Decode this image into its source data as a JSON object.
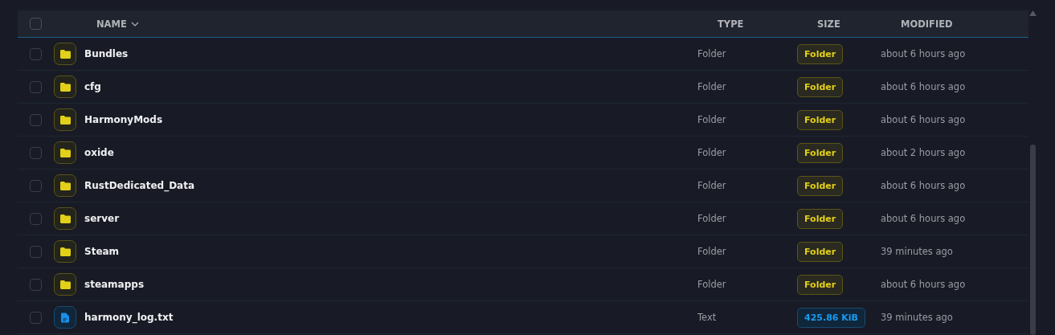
{
  "table": {
    "select_all": {
      "checked": false
    },
    "columns": [
      {
        "label": "NAME",
        "sorted": true
      },
      {
        "label": "TYPE",
        "sorted": false
      },
      {
        "label": "SIZE",
        "sorted": false
      },
      {
        "label": "MODIFIED",
        "sorted": false
      }
    ],
    "rows": [
      {
        "kind": "folder",
        "name": "Bundles",
        "type": "Folder",
        "size": "Folder",
        "modified": "about 6 hours ago",
        "checked": false
      },
      {
        "kind": "folder",
        "name": "cfg",
        "type": "Folder",
        "size": "Folder",
        "modified": "about 6 hours ago",
        "checked": false
      },
      {
        "kind": "folder",
        "name": "HarmonyMods",
        "type": "Folder",
        "size": "Folder",
        "modified": "about 6 hours ago",
        "checked": false
      },
      {
        "kind": "folder",
        "name": "oxide",
        "type": "Folder",
        "size": "Folder",
        "modified": "about 2 hours ago",
        "checked": false
      },
      {
        "kind": "folder",
        "name": "RustDedicated_Data",
        "type": "Folder",
        "size": "Folder",
        "modified": "about 6 hours ago",
        "checked": false
      },
      {
        "kind": "folder",
        "name": "server",
        "type": "Folder",
        "size": "Folder",
        "modified": "about 6 hours ago",
        "checked": false
      },
      {
        "kind": "folder",
        "name": "Steam",
        "type": "Folder",
        "size": "Folder",
        "modified": "39 minutes ago",
        "checked": false
      },
      {
        "kind": "folder",
        "name": "steamapps",
        "type": "Folder",
        "size": "Folder",
        "modified": "about 6 hours ago",
        "checked": false
      },
      {
        "kind": "file",
        "name": "harmony_log.txt",
        "type": "Text",
        "size": "425.86 KiB",
        "modified": "39 minutes ago",
        "checked": false
      }
    ]
  }
}
